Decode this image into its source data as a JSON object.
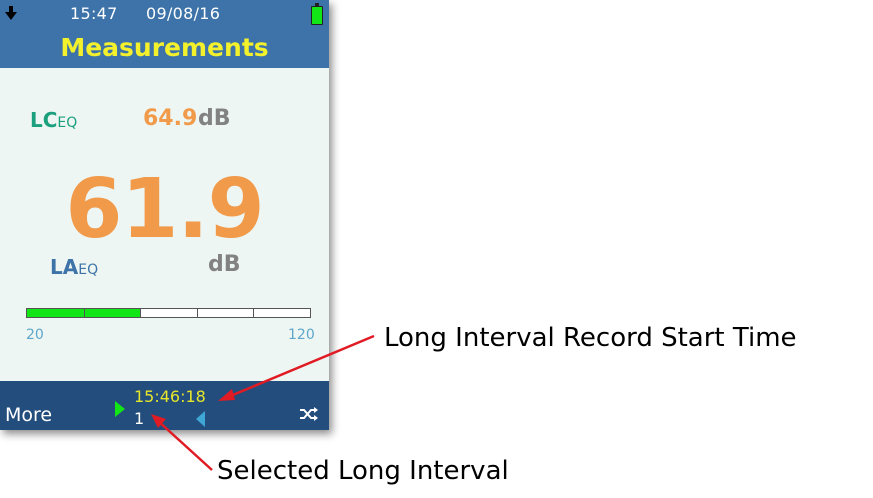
{
  "status_bar": {
    "time": "15:47",
    "date": "09/08/16",
    "download_icon": "download-arrow-icon",
    "battery_icon": "battery-full-icon"
  },
  "header": {
    "title": "Measurements"
  },
  "lceq": {
    "label_main": "LC",
    "label_sub": "EQ",
    "value": "64.9",
    "unit": "dB"
  },
  "laeq": {
    "value": "61.9",
    "label_main": "LA",
    "label_sub": "EQ",
    "unit": "dB"
  },
  "level_bar": {
    "min": "20",
    "max": "120",
    "fill_fraction": 0.4,
    "segments": 5
  },
  "footer": {
    "more_label": "More",
    "record_time": "15:46:18",
    "interval_index": "1",
    "shuffle_icon": "shuffle-icon"
  },
  "annotations": {
    "record_start": "Long Interval Record Start Time",
    "selected_interval": "Selected Long Interval"
  },
  "colors": {
    "header_bg": "#3d73a8",
    "title": "#f3f02c",
    "value_orange": "#f09a4a",
    "lceq_green": "#1aa07d",
    "bar_green": "#13e617",
    "footer_bg": "#234d7c",
    "arrow_red": "#e01b24"
  }
}
